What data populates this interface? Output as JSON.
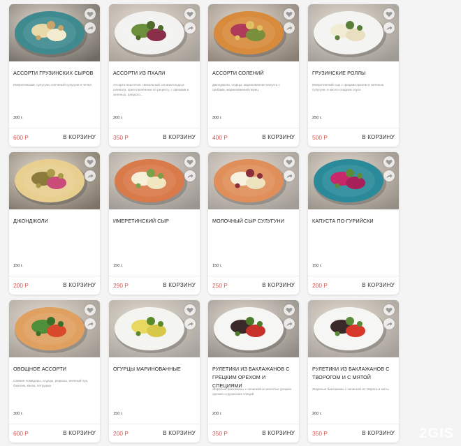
{
  "currency_note": "₽",
  "cart_label": "В КОРЗИНУ",
  "watermark": "2GIS",
  "colors": {
    "price": "#d9534f",
    "card_bg": "#ffffff",
    "page_bg": "#f4f4f4"
  },
  "products": [
    {
      "name": "Ассорти грузинских сыров",
      "desc": "Имеретинский, сулугуни, копченый сулугуни и чечил",
      "weight": "300 г.",
      "price": "600 Р",
      "plate": "#3f8a8f",
      "food": [
        "#e8d9a8",
        "#f4ecd0",
        "#c9a56a"
      ],
      "bg": "#6f6a63"
    },
    {
      "name": "Ассорти из пхали",
      "desc": "Ассорти паштетов: свекольный, из мангольда и шпината, приготовленные по рецепту, с орехами и зеленью, грецкого...",
      "weight": "200 г.",
      "price": "350 Р",
      "plate": "#f2f2f0",
      "food": [
        "#6b8f3a",
        "#8a2f4a",
        "#4e6b2a"
      ],
      "bg": "#a69f97"
    },
    {
      "name": "Ассорти солений",
      "desc": "Джонджоли, огурцы, маринованная капуста с грибами, маринованный перец",
      "weight": "300 г.",
      "price": "400 Р",
      "plate": "#d88b3c",
      "food": [
        "#b03a5a",
        "#7a8f3c",
        "#e0c060"
      ],
      "bg": "#8a7f74"
    },
    {
      "name": "Грузинские роллы",
      "desc": "Имеретинский сыр с грецким орехом и зеленью, сулугуни, в кисло-сладком соусе",
      "weight": "250 г.",
      "price": "500 Р",
      "plate": "#f4f4f2",
      "food": [
        "#f3ecd5",
        "#e8dfc0",
        "#5a7f3a"
      ],
      "bg": "#9e9a94"
    },
    {
      "name": "Джонджоли",
      "desc": "",
      "weight": "150 г.",
      "price": "200 Р",
      "plate": "#e8cf8f",
      "food": [
        "#8b7a3a",
        "#c84b7a",
        "#a89a4a"
      ],
      "bg": "#7d7467"
    },
    {
      "name": "Имеретинский сыр",
      "desc": "",
      "weight": "150 г.",
      "price": "290 Р",
      "plate": "#d97a4a",
      "food": [
        "#f6f0d8",
        "#f0e6c0",
        "#7aa04a"
      ],
      "bg": "#9a9590"
    },
    {
      "name": "Молочный сыр сулугуни",
      "desc": "",
      "weight": "150 г.",
      "price": "250 Р",
      "plate": "#e08f5a",
      "food": [
        "#f6f1dc",
        "#ede3bf",
        "#8a2f3a"
      ],
      "bg": "#a19c96"
    },
    {
      "name": "Капуста по-гурийски",
      "desc": "",
      "weight": "150 г.",
      "price": "200 Р",
      "plate": "#2a8a9a",
      "food": [
        "#c8286a",
        "#a8205a",
        "#5f8a3a"
      ],
      "bg": "#958e86"
    },
    {
      "name": "Овощное ассорти",
      "desc": "Свежие помидоры, огурцы, редиска, зеленый лук, базилик, кинза, петрушка",
      "weight": "300 г.",
      "price": "600 Р",
      "plate": "#e0a060",
      "food": [
        "#4f8f3a",
        "#d8482a",
        "#3a6f2a"
      ],
      "bg": "#a09a92"
    },
    {
      "name": "Огурцы маринованные",
      "desc": "",
      "weight": "150 г.",
      "price": "200 Р",
      "plate": "#f4f4f0",
      "food": [
        "#e8d860",
        "#d8c84a",
        "#5a8a2a"
      ],
      "bg": "#a6a29c"
    },
    {
      "name": "Рулетики из баклажанов с грецким орехом и специями",
      "desc": "Жареные баклажаны с начинкой из молотых грецких орехов и грузинских специй",
      "weight": "200 г.",
      "price": "350 Р",
      "plate": "#f6f6f4",
      "food": [
        "#3a2a2a",
        "#c8302a",
        "#4a7a2a"
      ],
      "bg": "#8f8a85"
    },
    {
      "name": "Рулетики из баклажанов с творогом и с мятой",
      "desc": "Жареные баклажаны с начинкой из творога и мяты",
      "weight": "200 г.",
      "price": "350 Р",
      "plate": "#f6f6f4",
      "food": [
        "#3a2a2a",
        "#d8382a",
        "#5a8a3a"
      ],
      "bg": "#a49f99"
    }
  ]
}
